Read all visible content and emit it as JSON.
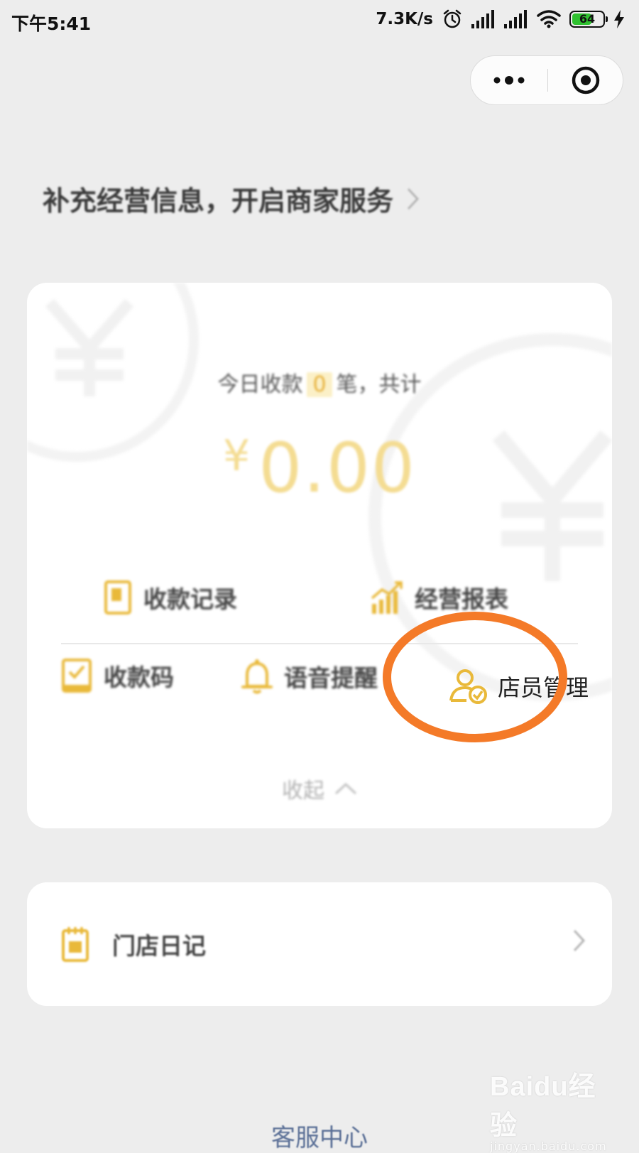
{
  "status_bar": {
    "time": "下午5:41",
    "net_speed": "7.3K/s",
    "battery_level": 64,
    "battery_text": "64",
    "icons": [
      "alarm-icon",
      "signal-icon",
      "signal-icon",
      "wifi-icon",
      "battery-icon",
      "charging-icon"
    ]
  },
  "capsule": {
    "more_icon": "more-dots-icon",
    "close_icon": "target-close-icon"
  },
  "merchant_banner": {
    "label": "补充经营信息，开启商家服务"
  },
  "summary": {
    "today_prefix": "今日收款",
    "today_count": "0",
    "today_suffix": "笔，共计",
    "currency": "¥",
    "amount": "0.00"
  },
  "menu": {
    "records": "收款记录",
    "reports": "经营报表",
    "pay_code": "收款码",
    "voice": "语音提醒",
    "staff": "店员管理",
    "collapse": "收起"
  },
  "store_diary": {
    "label": "门店日记"
  },
  "footer": {
    "service": "客服中心"
  },
  "watermark": {
    "brand": "Baidu经验",
    "url": "jingyan.baidu.com"
  },
  "colors": {
    "accent": "#e9b93a",
    "highlight": "#f47a28",
    "background": "#ededed"
  }
}
